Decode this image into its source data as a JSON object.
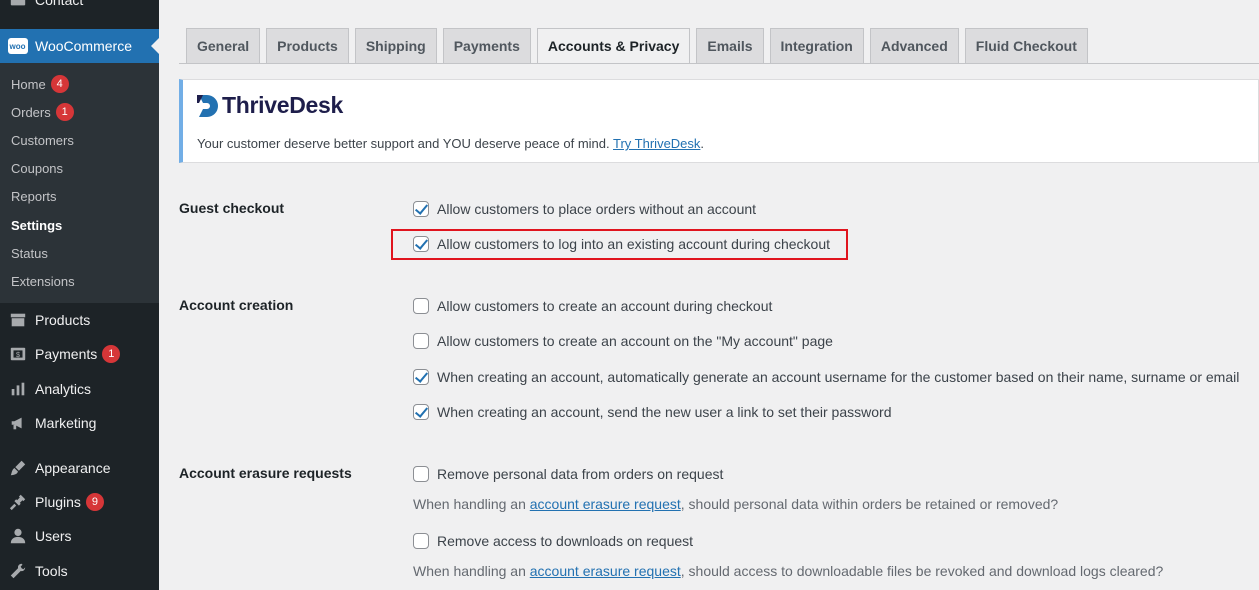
{
  "sidebar": {
    "top_cut": "Contact",
    "woocommerce": "WooCommerce",
    "woo_logo_text": "woo",
    "submenu": [
      {
        "label": "Home",
        "badge": "4"
      },
      {
        "label": "Orders",
        "badge": "1"
      },
      {
        "label": "Customers"
      },
      {
        "label": "Coupons"
      },
      {
        "label": "Reports"
      },
      {
        "label": "Settings",
        "current": true
      },
      {
        "label": "Status"
      },
      {
        "label": "Extensions"
      }
    ],
    "products": "Products",
    "payments": "Payments",
    "payments_badge": "1",
    "analytics": "Analytics",
    "marketing": "Marketing",
    "appearance": "Appearance",
    "plugins": "Plugins",
    "plugins_badge": "9",
    "users": "Users",
    "tools": "Tools"
  },
  "tabs": [
    "General",
    "Products",
    "Shipping",
    "Payments",
    "Accounts & Privacy",
    "Emails",
    "Integration",
    "Advanced",
    "Fluid Checkout"
  ],
  "active_tab": "Accounts & Privacy",
  "notice": {
    "brand": "ThriveDesk",
    "text": "Your customer deserve better support and YOU deserve peace of mind.",
    "link": "Try ThriveDesk",
    "end": "."
  },
  "settings": {
    "guest_checkout": {
      "label": "Guest checkout",
      "options": [
        {
          "text": "Allow customers to place orders without an account",
          "checked": true
        },
        {
          "text": "Allow customers to log into an existing account during checkout",
          "checked": true
        }
      ]
    },
    "account_creation": {
      "label": "Account creation",
      "options": [
        {
          "text": "Allow customers to create an account during checkout",
          "checked": false
        },
        {
          "text": "Allow customers to create an account on the \"My account\" page",
          "checked": false
        },
        {
          "text": "When creating an account, automatically generate an account username for the customer based on their name, surname or email",
          "checked": true
        },
        {
          "text": "When creating an account, send the new user a link to set their password",
          "checked": true
        }
      ]
    },
    "erasure": {
      "label": "Account erasure requests",
      "opt1": "Remove personal data from orders on request",
      "desc1_pre": "When handling an",
      "desc1_link": "account erasure request",
      "desc1_post": ", should personal data within orders be retained or removed?",
      "opt2": "Remove access to downloads on request",
      "desc2_pre": "When handling an",
      "desc2_link": "account erasure request",
      "desc2_post": ", should access to downloadable files be revoked and download logs cleared?"
    }
  },
  "colors": {
    "accent": "#2271b1",
    "sidebar": "#1d2327",
    "highlight": "#e0141e",
    "badge": "#d63638"
  }
}
